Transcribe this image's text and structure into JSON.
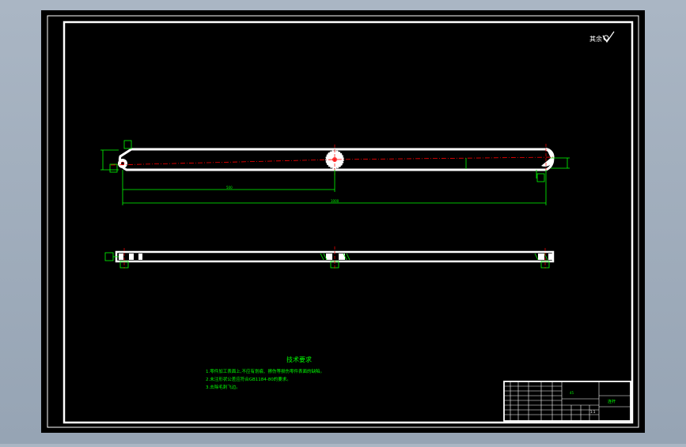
{
  "drawing": {
    "roughness_mark": "其余",
    "notes_title": "技术要求",
    "notes": [
      "1.零件加工表面上,不应有划痕、擦伤等损伤零件表面的缺陷。",
      "2.未注形状公差应符合GB1184-80的要求。",
      "3.去除毛刺飞边。"
    ],
    "dimensions": {
      "center_span": "500",
      "overall_span": "1000"
    },
    "title_block": {
      "part_name": "连杆",
      "scale": "1:1",
      "material": "45"
    }
  },
  "colors": {
    "background": "#000000",
    "frame": "#ffffff",
    "dimension": "#00ff00",
    "centerline": "#ff0000"
  }
}
